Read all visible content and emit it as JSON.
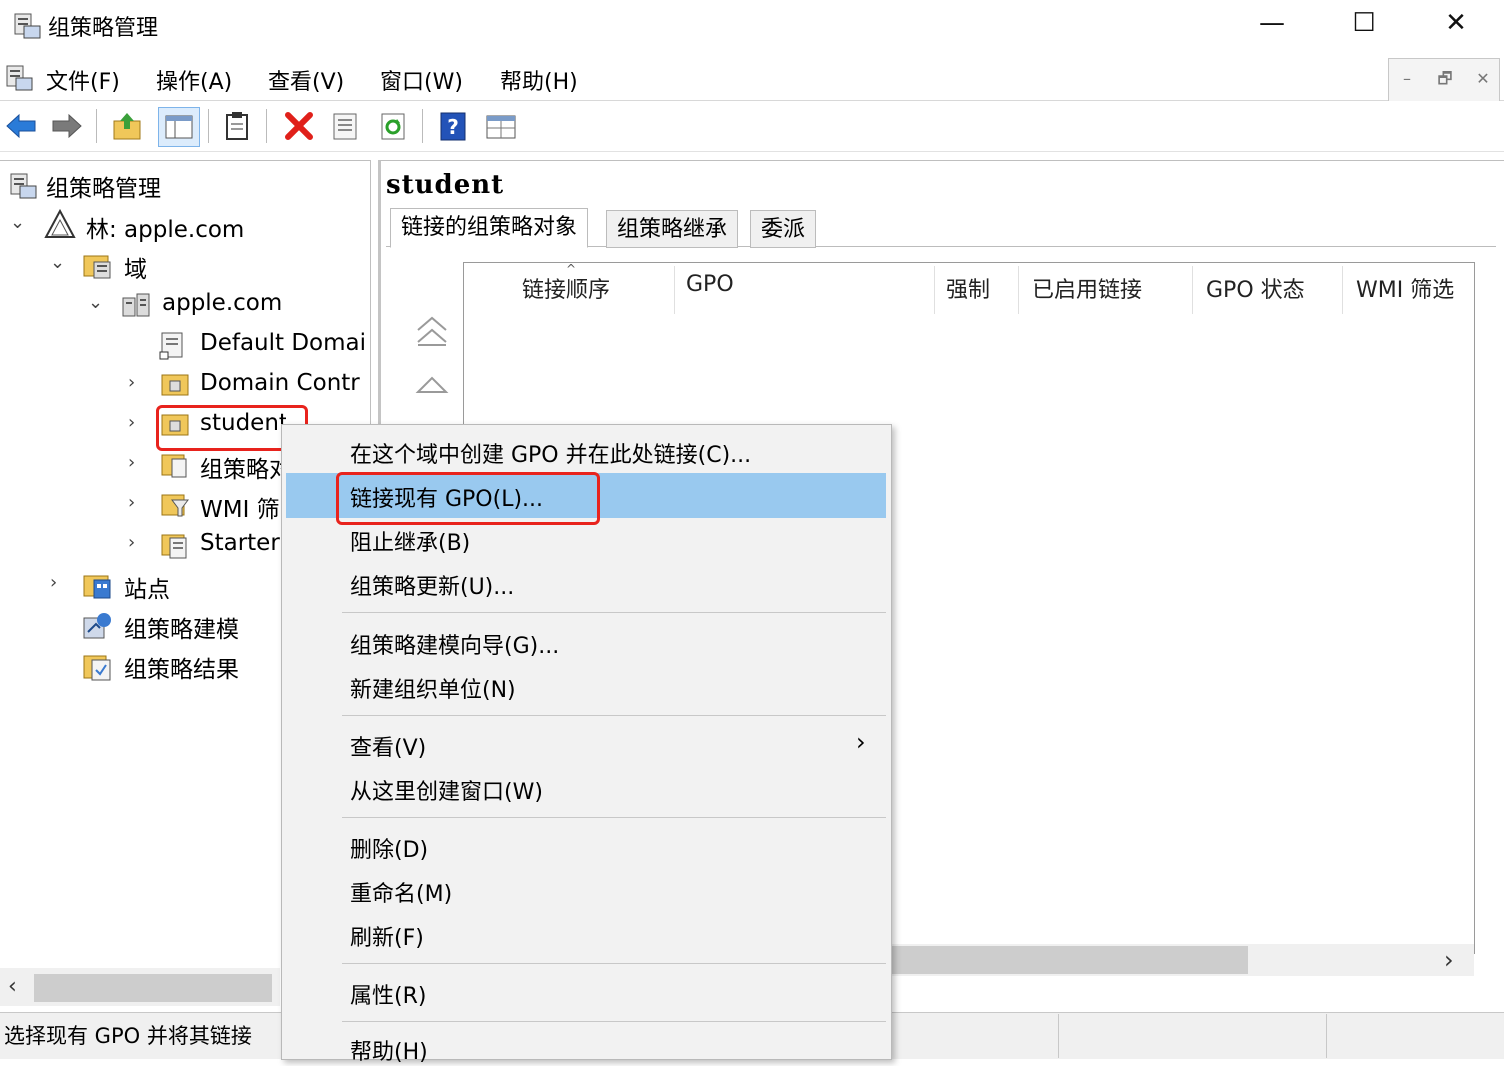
{
  "window": {
    "title": "组策略管理",
    "controls": {
      "minimize": "—",
      "maximize": "☐",
      "close": "✕"
    }
  },
  "menubar": {
    "items": [
      "文件(F)",
      "操作(A)",
      "查看(V)",
      "窗口(W)",
      "帮助(H)"
    ],
    "mdi": {
      "minimize": "–",
      "restore": "🗗",
      "close": "✕"
    }
  },
  "toolbar": {
    "icons": [
      "back-arrow-icon",
      "forward-arrow-icon",
      "up-folder-icon",
      "show-tree-icon",
      "clipboard-icon",
      "delete-icon",
      "properties-icon",
      "refresh-icon",
      "help-icon",
      "console-icon"
    ]
  },
  "tree": {
    "root": "组策略管理",
    "forest": "林: apple.com",
    "domains": "域",
    "domain": "apple.com",
    "children": [
      "Default Domai",
      "Domain Contr",
      "student",
      "组策略对",
      "WMI 筛",
      "Starter"
    ],
    "sites": "站点",
    "modeling": "组策略建模",
    "results": "组策略结果"
  },
  "right": {
    "title": "student",
    "tabs": [
      "链接的组策略对象",
      "组策略继承",
      "委派"
    ],
    "columns": [
      "链接顺序",
      "GPO",
      "强制",
      "已启用链接",
      "GPO 状态",
      "WMI 筛选"
    ]
  },
  "context_menu": {
    "items": [
      "在这个域中创建 GPO 并在此处链接(C)...",
      "链接现有 GPO(L)...",
      "阻止继承(B)",
      "组策略更新(U)...",
      "组策略建模向导(G)...",
      "新建组织单位(N)",
      "查看(V)",
      "从这里创建窗口(W)",
      "删除(D)",
      "重命名(M)",
      "刷新(F)",
      "属性(R)",
      "帮助(H)"
    ],
    "submenu_arrow": "›"
  },
  "statusbar": {
    "text": "选择现有 GPO 并将其链接"
  },
  "scroll": {
    "left_arrow": "‹",
    "right_arrow": "›"
  },
  "colors": {
    "highlight": "#99c9ef",
    "annotation": "#e8231d",
    "accent_blue": "#1f6fd6"
  }
}
